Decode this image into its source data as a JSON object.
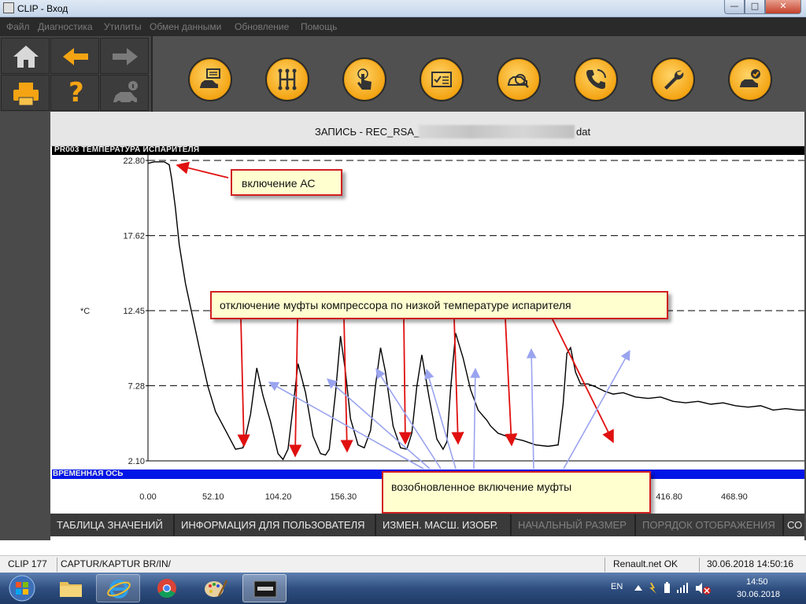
{
  "window": {
    "title": "CLIP - Вход"
  },
  "menu": [
    "Файл",
    "Диагностика",
    "Утилиты",
    "Обмен данными",
    "Обновление",
    "Помощь"
  ],
  "toolbar": {
    "nav_icons": [
      "home-icon",
      "back-arrow-icon",
      "forward-arrow-icon",
      "printer-icon",
      "help-icon",
      "car-info-icon"
    ],
    "help_glyph": "?",
    "function_icons": [
      "vehicle-identification-icon",
      "gearbox-icon",
      "touch-icon",
      "checklist-icon",
      "diagnostic-scan-icon",
      "phone-support-icon",
      "wrench-icon",
      "vehicle-check-icon"
    ],
    "accent_color": "#f4a413"
  },
  "record": {
    "title_prefix": "ЗАПИСЬ - REC_RSA_",
    "title_suffix": "dat"
  },
  "parameter_label": "PR003  ТЕМПЕРАТУРА ИСПАРИТЕЛЯ",
  "time_axis_label": "ВРЕМЕННАЯ ОСЬ",
  "chart_data": {
    "type": "line",
    "ylabel": "*C",
    "ylim": [
      2.1,
      22.8
    ],
    "yticks": [
      "22.80",
      "17.62",
      "12.45",
      "7.28",
      "2.10"
    ],
    "xlim": [
      0,
      525
    ],
    "xticks": [
      "0.00",
      "52.10",
      "104.20",
      "156.30",
      "416.80",
      "468.90"
    ],
    "grid": "dashed-horizontal",
    "line_color": "#000000",
    "series": [
      {
        "x": [
          0,
          5,
          13,
          17,
          19,
          22,
          25,
          30,
          36,
          42,
          48,
          54,
          62,
          70,
          76,
          82,
          87,
          92,
          98,
          104,
          108,
          112,
          116,
          120,
          126,
          132,
          138,
          142,
          145,
          150,
          154,
          158,
          162,
          168,
          173,
          178,
          182,
          186,
          190,
          196,
          202,
          207,
          211,
          215,
          219,
          225,
          231,
          236,
          239,
          242,
          246,
          252,
          258,
          264,
          268,
          271,
          274,
          280,
          290,
          300,
          310,
          320,
          328,
          332,
          335,
          338,
          342,
          346,
          352,
          358,
          365,
          372,
          380,
          390,
          400,
          410,
          420,
          430,
          440,
          450,
          460,
          470,
          480,
          490,
          500,
          510,
          520,
          525
        ],
        "y": [
          22.6,
          22.7,
          22.7,
          22.5,
          21.5,
          19.5,
          17.0,
          14.3,
          11.9,
          9.5,
          7.2,
          5.5,
          4.2,
          2.9,
          3.0,
          5.3,
          8.5,
          6.6,
          4.8,
          2.6,
          2.2,
          2.9,
          5.8,
          8.8,
          6.8,
          3.8,
          2.6,
          2.5,
          2.9,
          6.8,
          10.7,
          8.2,
          5.0,
          3.2,
          3.0,
          4.2,
          7.3,
          9.9,
          8.2,
          4.5,
          3.0,
          2.9,
          4.0,
          7.2,
          9.4,
          6.4,
          3.6,
          2.9,
          3.4,
          7.0,
          10.9,
          9.2,
          7.0,
          5.6,
          5.2,
          4.9,
          4.5,
          4.0,
          3.7,
          3.5,
          3.2,
          3.1,
          3.2,
          6.0,
          9.5,
          9.9,
          8.2,
          7.4,
          7.4,
          7.2,
          6.9,
          6.7,
          6.8,
          6.5,
          6.4,
          6.5,
          6.2,
          6.1,
          6.2,
          6.0,
          6.1,
          5.9,
          5.8,
          5.9,
          5.6,
          5.7,
          5.6,
          5.6
        ]
      }
    ],
    "annotations": [
      {
        "text": "включение АС"
      },
      {
        "text": "отключение муфты компрессора по низкой температуре испарителя"
      },
      {
        "text": "возобновленное включение муфты"
      }
    ],
    "annotation_colors": {
      "red_arrow": "#e01010",
      "blue_arrow": "#9aa4ef",
      "box_fill": "#ffffd0",
      "box_border": "#d02020"
    }
  },
  "footer_buttons": [
    {
      "label": "ТАБЛИЦА ЗНАЧЕНИЙ",
      "enabled": true
    },
    {
      "label": "ИНФОРМАЦИЯ ДЛЯ ПОЛЬЗОВАТЕЛЯ",
      "enabled": true
    },
    {
      "label": "ИЗМЕН. МАСШ. ИЗОБР.",
      "enabled": true
    },
    {
      "label": "НАЧАЛЬНЫЙ РАЗМЕР",
      "enabled": false
    },
    {
      "label": "ПОРЯДОК ОТОБРАЖЕНИЯ",
      "enabled": false
    },
    {
      "label": "СО",
      "enabled": true
    }
  ],
  "status": {
    "clip_version": "CLIP 177",
    "vehicle": "CAPTUR/KAPTUR BR/IN/",
    "connection": "Renault.net OK",
    "datetime": "30.06.2018 14:50:16"
  },
  "taskbar": {
    "apps": [
      "explorer-icon",
      "internet-explorer-icon",
      "chrome-icon",
      "paint-icon",
      "clip-app-icon"
    ],
    "language": "EN",
    "clock_time": "14:50",
    "clock_date": "30.06.2018"
  }
}
